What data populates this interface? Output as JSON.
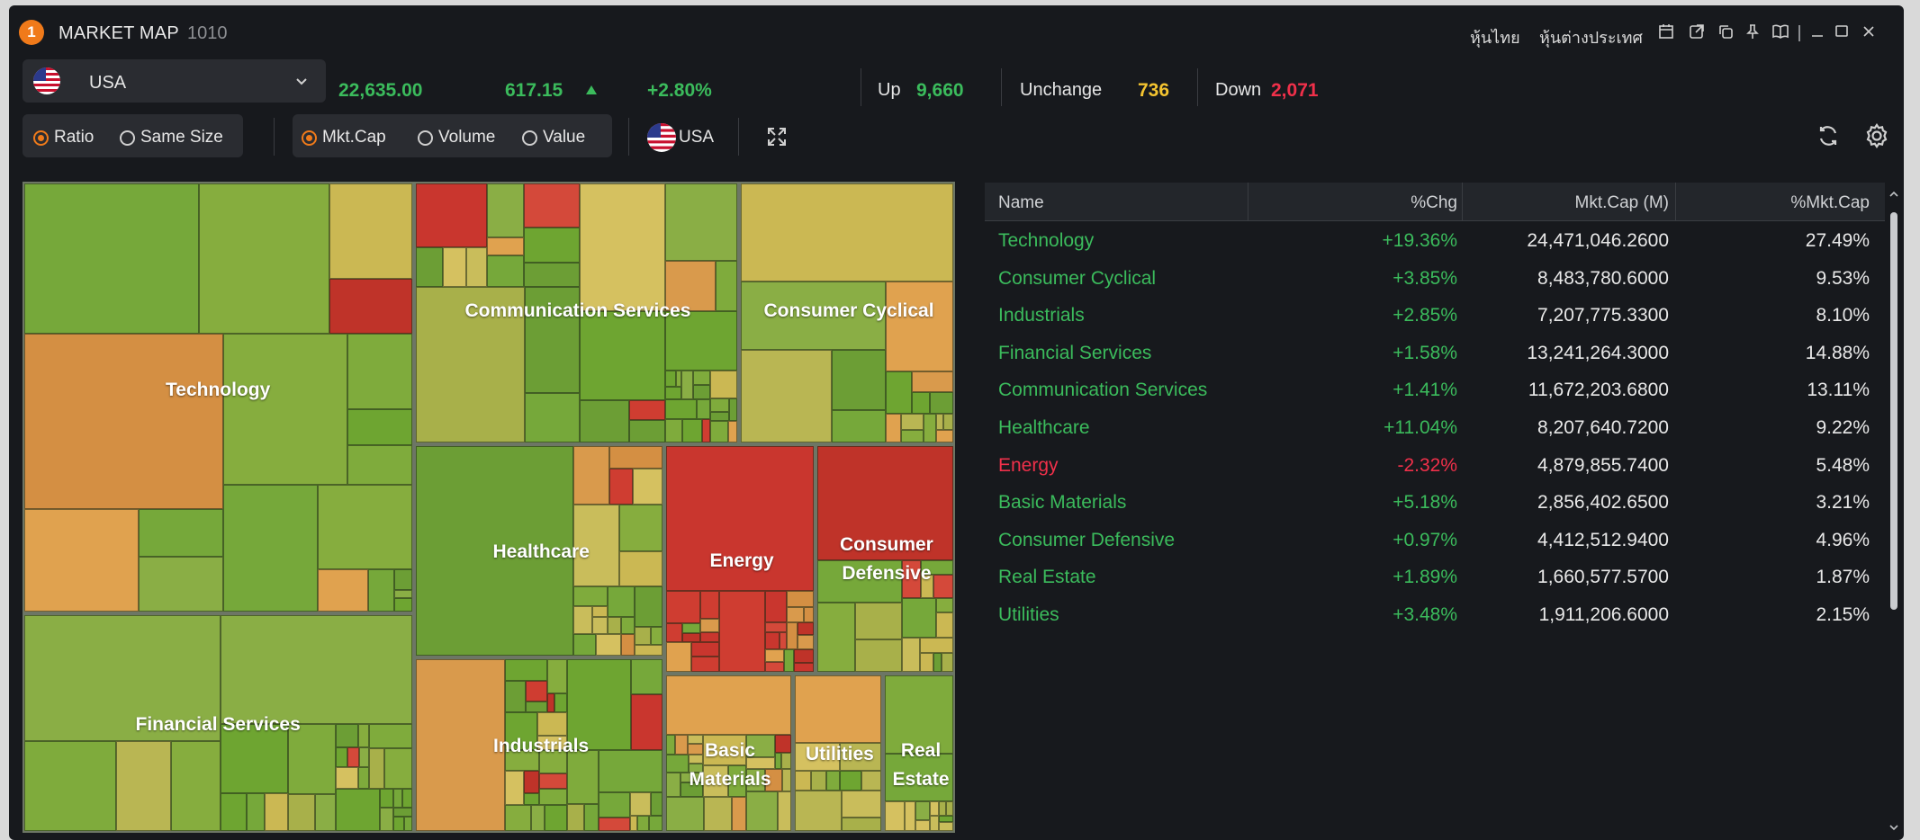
{
  "window": {
    "badge": "1",
    "title": "MARKET MAP",
    "code": "1010",
    "links": [
      "หุ้นไทย",
      "หุ้นต่างประเทศ"
    ],
    "title_icons": [
      "calendar-icon",
      "external-link-icon",
      "copy-icon",
      "pin-icon",
      "book-icon",
      "minimize-icon",
      "maximize-icon",
      "close-icon"
    ]
  },
  "market": {
    "selected": "USA",
    "index_value": "22,635.00",
    "change": "617.15",
    "change_pct": "+2.80%",
    "up_label": "Up",
    "up_value": "9,660",
    "unchange_label": "Unchange",
    "unchange_value": "736",
    "down_label": "Down",
    "down_value": "2,071"
  },
  "options": {
    "ratio_label": "Ratio",
    "same_size_label": "Same Size",
    "size_mode": "Ratio",
    "mktcap_label": "Mkt.Cap",
    "volume_label": "Volume",
    "value_label": "Value",
    "metric": "Mkt.Cap",
    "region_label": "USA"
  },
  "colors": {
    "up": "#3bbb5c",
    "down": "#f0304a",
    "neutral": "#f4c430",
    "accent": "#f07a1a"
  },
  "treemap": {
    "sectors": [
      {
        "name": "Technology",
        "label": "Technology"
      },
      {
        "name": "Communication Services",
        "label": "Communication Services"
      },
      {
        "name": "Consumer Cyclical",
        "label": "Consumer Cyclical"
      },
      {
        "name": "Healthcare",
        "label": "Healthcare"
      },
      {
        "name": "Energy",
        "label": "Energy"
      },
      {
        "name": "Consumer Defensive",
        "label": "Consumer\nDefensive"
      },
      {
        "name": "Financial Services",
        "label": "Financial Services"
      },
      {
        "name": "Industrials",
        "label": "Industrials"
      },
      {
        "name": "Basic Materials",
        "label": "Basic\nMaterials"
      },
      {
        "name": "Utilities",
        "label": "Utilities"
      },
      {
        "name": "Real Estate",
        "label": "Real\nEstate"
      }
    ]
  },
  "table": {
    "headers": [
      "Name",
      "%Chg",
      "Mkt.Cap (M)",
      "%Mkt.Cap"
    ],
    "rows": [
      {
        "name": "Technology",
        "chg": "+19.36%",
        "mktcap": "24,471,046.2600",
        "pct": "27.49%",
        "dir": "up"
      },
      {
        "name": "Consumer Cyclical",
        "chg": "+3.85%",
        "mktcap": "8,483,780.6000",
        "pct": "9.53%",
        "dir": "up"
      },
      {
        "name": "Industrials",
        "chg": "+2.85%",
        "mktcap": "7,207,775.3300",
        "pct": "8.10%",
        "dir": "up"
      },
      {
        "name": "Financial Services",
        "chg": "+1.58%",
        "mktcap": "13,241,264.3000",
        "pct": "14.88%",
        "dir": "up"
      },
      {
        "name": "Communication Services",
        "chg": "+1.41%",
        "mktcap": "11,672,203.6800",
        "pct": "13.11%",
        "dir": "up"
      },
      {
        "name": "Healthcare",
        "chg": "+11.04%",
        "mktcap": "8,207,640.7200",
        "pct": "9.22%",
        "dir": "up"
      },
      {
        "name": "Energy",
        "chg": "-2.32%",
        "mktcap": "4,879,855.7400",
        "pct": "5.48%",
        "dir": "down"
      },
      {
        "name": "Basic Materials",
        "chg": "+5.18%",
        "mktcap": "2,856,402.6500",
        "pct": "3.21%",
        "dir": "up"
      },
      {
        "name": "Consumer Defensive",
        "chg": "+0.97%",
        "mktcap": "4,412,512.9400",
        "pct": "4.96%",
        "dir": "up"
      },
      {
        "name": "Real Estate",
        "chg": "+1.89%",
        "mktcap": "1,660,577.5700",
        "pct": "1.87%",
        "dir": "up"
      },
      {
        "name": "Utilities",
        "chg": "+3.48%",
        "mktcap": "1,911,206.6000",
        "pct": "2.15%",
        "dir": "up"
      }
    ]
  }
}
